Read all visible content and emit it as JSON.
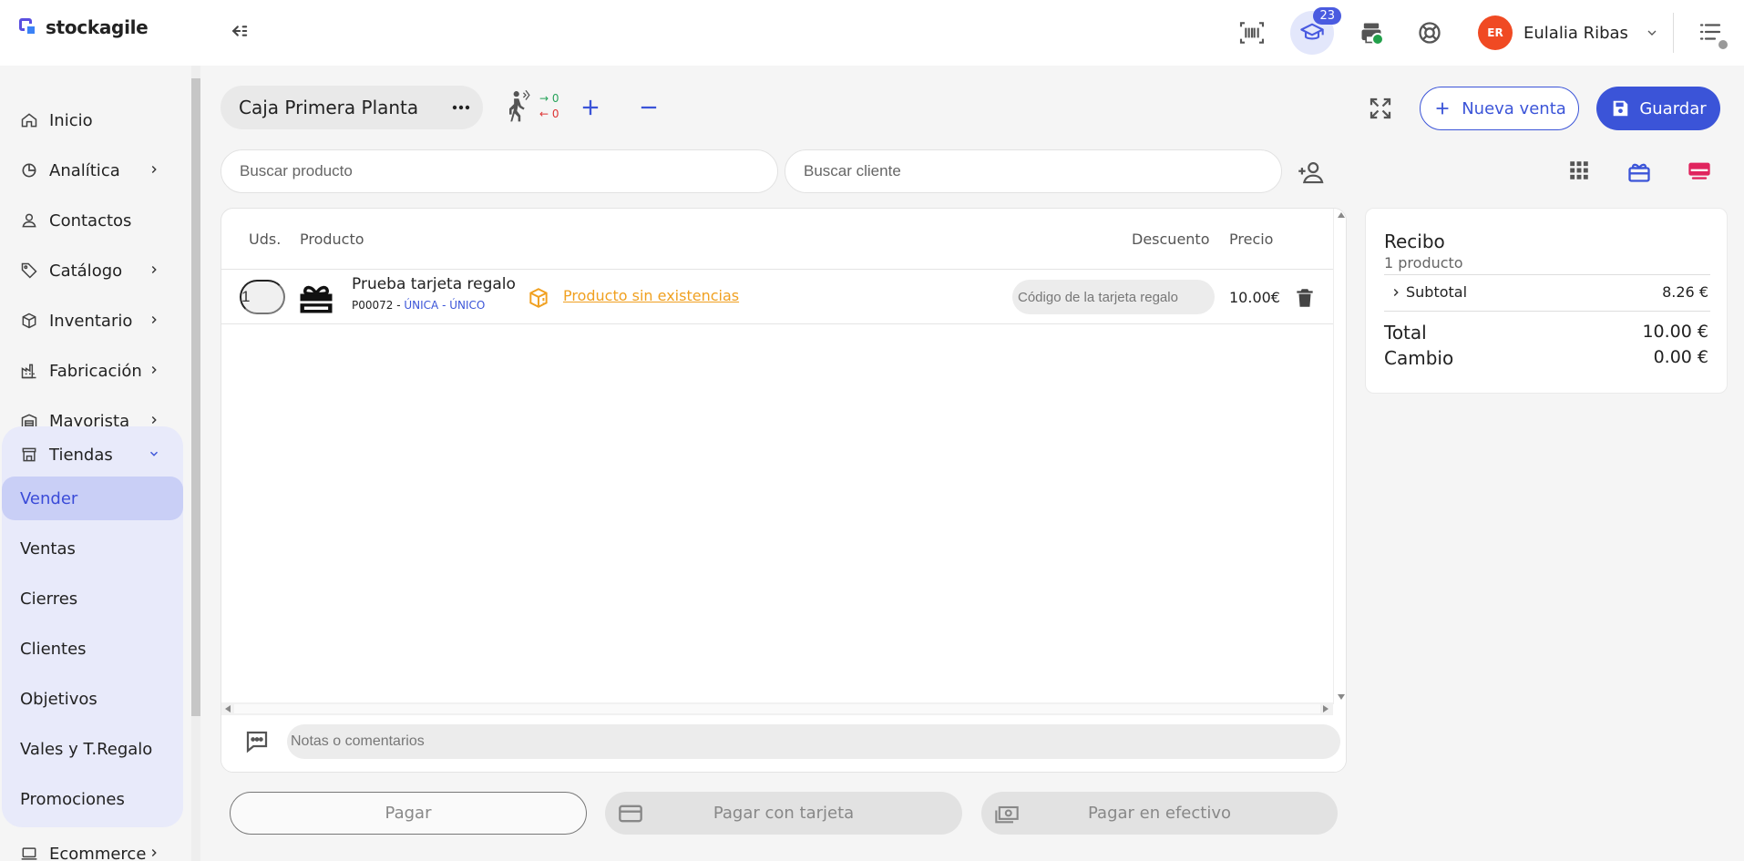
{
  "app": {
    "brand": "stockagile",
    "accent": "#3b54d8"
  },
  "topbar": {
    "notifications_count": "23",
    "user": {
      "initials": "ER",
      "name": "Eulalia Ribas",
      "avatar_color": "#f04a23"
    }
  },
  "sidebar": {
    "items": [
      {
        "label": "Inicio",
        "icon": "home-icon"
      },
      {
        "label": "Analítica",
        "icon": "chart-icon"
      },
      {
        "label": "Contactos",
        "icon": "person-icon"
      },
      {
        "label": "Catálogo",
        "icon": "tag-icon"
      },
      {
        "label": "Inventario",
        "icon": "box-icon"
      },
      {
        "label": "Fabricación",
        "icon": "factory-icon"
      },
      {
        "label": "Mayorista",
        "icon": "warehouse-icon"
      },
      {
        "label": "Tiendas",
        "icon": "store-icon"
      }
    ],
    "shop_subitems": [
      "Vender",
      "Ventas",
      "Cierres",
      "Clientes",
      "Objetivos",
      "Vales y T.Regalo",
      "Promociones"
    ],
    "after": {
      "label": "Ecommerce",
      "icon": "laptop-icon"
    }
  },
  "pos": {
    "register_name": "Caja Primera Planta",
    "visitors_in": "0",
    "visitors_out": "0",
    "new_sale_label": "Nueva venta",
    "save_label": "Guardar",
    "search_product_placeholder": "Buscar producto",
    "search_client_placeholder": "Buscar cliente"
  },
  "table": {
    "columns": {
      "qty": "Uds.",
      "product": "Producto",
      "discount": "Descuento",
      "price": "Precio"
    },
    "rows": [
      {
        "qty": "1",
        "name": "Prueba tarjeta regalo",
        "ref": "P00072 - ",
        "variant": "ÚNICA - ÚNICO",
        "warning": "Producto sin existencias",
        "code_placeholder": "Código de la tarjeta regalo",
        "price": "10.00€"
      }
    ],
    "notes_placeholder": "Notas o comentarios"
  },
  "receipt": {
    "title": "Recibo",
    "count": "1 producto",
    "subtotal_label": "Subtotal",
    "subtotal_value": "8.26 €",
    "total_label": "Total",
    "total_value": "10.00 €",
    "change_label": "Cambio",
    "change_value": "0.00 €"
  },
  "pay": {
    "pay_label": "Pagar",
    "card_label": "Pagar con tarjeta",
    "cash_label": "Pagar en efectivo"
  }
}
